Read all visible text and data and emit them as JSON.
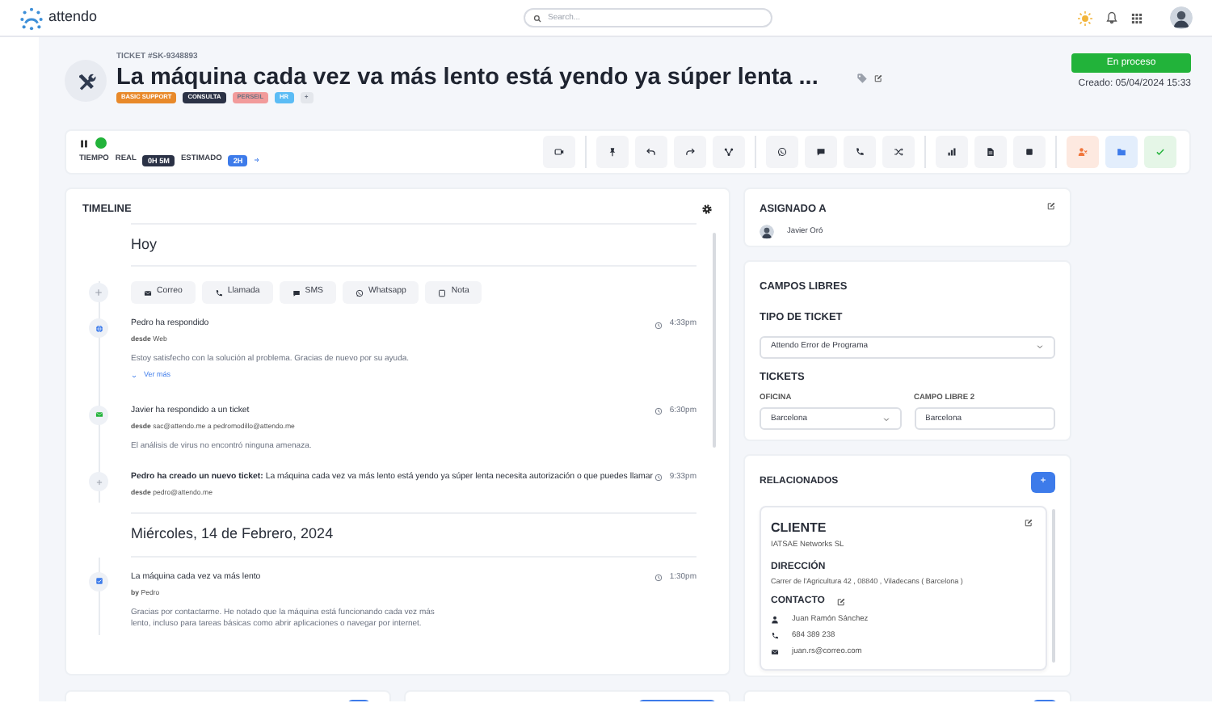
{
  "brand": "attendo",
  "search": {
    "placeholder": "Search..."
  },
  "ticket": {
    "label": "TICKET",
    "number": "#SK-9348893",
    "title": "La máquina cada vez va más lento está yendo ya súper lenta ...",
    "tags": [
      {
        "text": "BASIC SUPPORT",
        "color": "#e8892a"
      },
      {
        "text": "CONSULTA",
        "color": "#2b3246"
      },
      {
        "text": "PERSEIL",
        "color": "#f29b9b"
      },
      {
        "text": "HR",
        "color": "#5bbcf5"
      },
      {
        "text": "+",
        "color": "#e4e7ec"
      }
    ],
    "status": "En proceso",
    "created": "Creado: 05/04/2024 15:33"
  },
  "timer": {
    "running": true,
    "label_time": "TIEMPO",
    "label_real": "REAL",
    "real": "0H 5M",
    "label_estimated": "ESTIMADO",
    "estimated": "2H"
  },
  "timeline": {
    "title": "TIMELINE",
    "groups": [
      {
        "date": "Hoy",
        "compose": [
          "Correo",
          "Llamada",
          "SMS",
          "Whatsapp",
          "Nota"
        ],
        "entries": [
          {
            "kind": "web",
            "title": "Pedro ha respondido",
            "source": {
              "label": "desde",
              "links": [
                "Web"
              ]
            },
            "time": "4:33pm",
            "body": "Estoy satisfecho con la solución al problema. Gracias de nuevo por su ayuda.",
            "more": "Ver más"
          },
          {
            "kind": "email",
            "title": "Javier ha respondido a un ticket",
            "source": {
              "label": "desde",
              "links": [
                "sac@attendo.me",
                "pedromodillo@attendo.me"
              ],
              "joiner": "a"
            },
            "time": "6:30pm",
            "body": "El análisis de virus no encontró ninguna amenaza."
          },
          {
            "kind": "created",
            "title": "**Pedro ha creado un nuevo ticket:** La máquina cada vez va más lento está yendo ya súper lenta necesita autorización o que puedes llamar",
            "source": {
              "label": "desde",
              "links": [
                "pedro@attendo.me"
              ]
            },
            "time": "9:33pm"
          }
        ]
      },
      {
        "date": "Miércoles, 14 de Febrero, 2024",
        "entries": [
          {
            "kind": "task",
            "title": "La máquina cada vez va más lento",
            "source": {
              "label": "by",
              "links": [
                "Pedro"
              ]
            },
            "time": "1:30pm",
            "body": "Gracias por contactarme. He notado que la máquina está funcionando cada vez más lento, incluso para tareas básicas como abrir aplicaciones o navegar por internet."
          }
        ]
      }
    ]
  },
  "assigned": {
    "title": "ASIGNADO A",
    "name": "Javier Oró"
  },
  "custom_fields": {
    "title": "CAMPOS LIBRES",
    "type_label": "TIPO DE TICKET",
    "type_value": "Attendo Error de Programa",
    "section": "TICKETS",
    "fields": [
      {
        "kind": "select",
        "label": "OFICINA",
        "value": "Barcelona"
      },
      {
        "kind": "text",
        "label": "CAMPO LIBRE 2",
        "value": "Barcelona"
      }
    ]
  },
  "related": {
    "title": "RELACIONADOS",
    "add": "+",
    "client": {
      "heading": "CLIENTE",
      "name": "IATSAE Networks SL",
      "address_heading": "DIRECCIÓN",
      "address": "Carrer de l'Agricultura 42 , 08840 , Viladecans ( Barcelona )",
      "contact_heading": "CONTACTO",
      "contact": [
        {
          "kind": "person",
          "text": "Juan Ramón Sánchez"
        },
        {
          "kind": "phone",
          "text": "684 389 238"
        },
        {
          "kind": "mail",
          "text": "juan.rs@correo.com"
        }
      ]
    }
  }
}
